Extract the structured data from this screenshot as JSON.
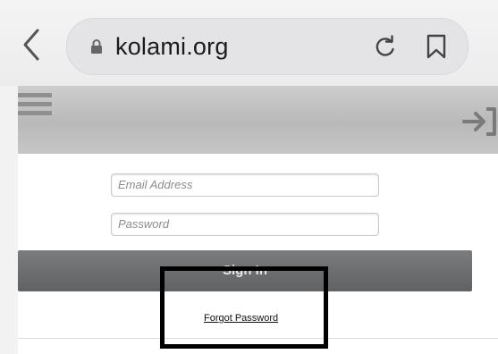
{
  "browser": {
    "url": "kolami.org",
    "icons": {
      "back": "chevron-left-icon",
      "lock": "lock-icon",
      "reload": "reload-icon",
      "bookmark": "bookmark-icon"
    }
  },
  "site_header": {
    "icons": {
      "menu": "hamburger-menu-icon",
      "login": "sign-in-icon"
    }
  },
  "login_form": {
    "email_placeholder": "Email Address",
    "password_placeholder": "Password",
    "signin_label": "Sign In",
    "forgot_password_label": "Forgot Password"
  },
  "colors": {
    "header_grey": "#c2c2c2",
    "button_grey": "#6b6d6f",
    "highlight": "#000000"
  }
}
